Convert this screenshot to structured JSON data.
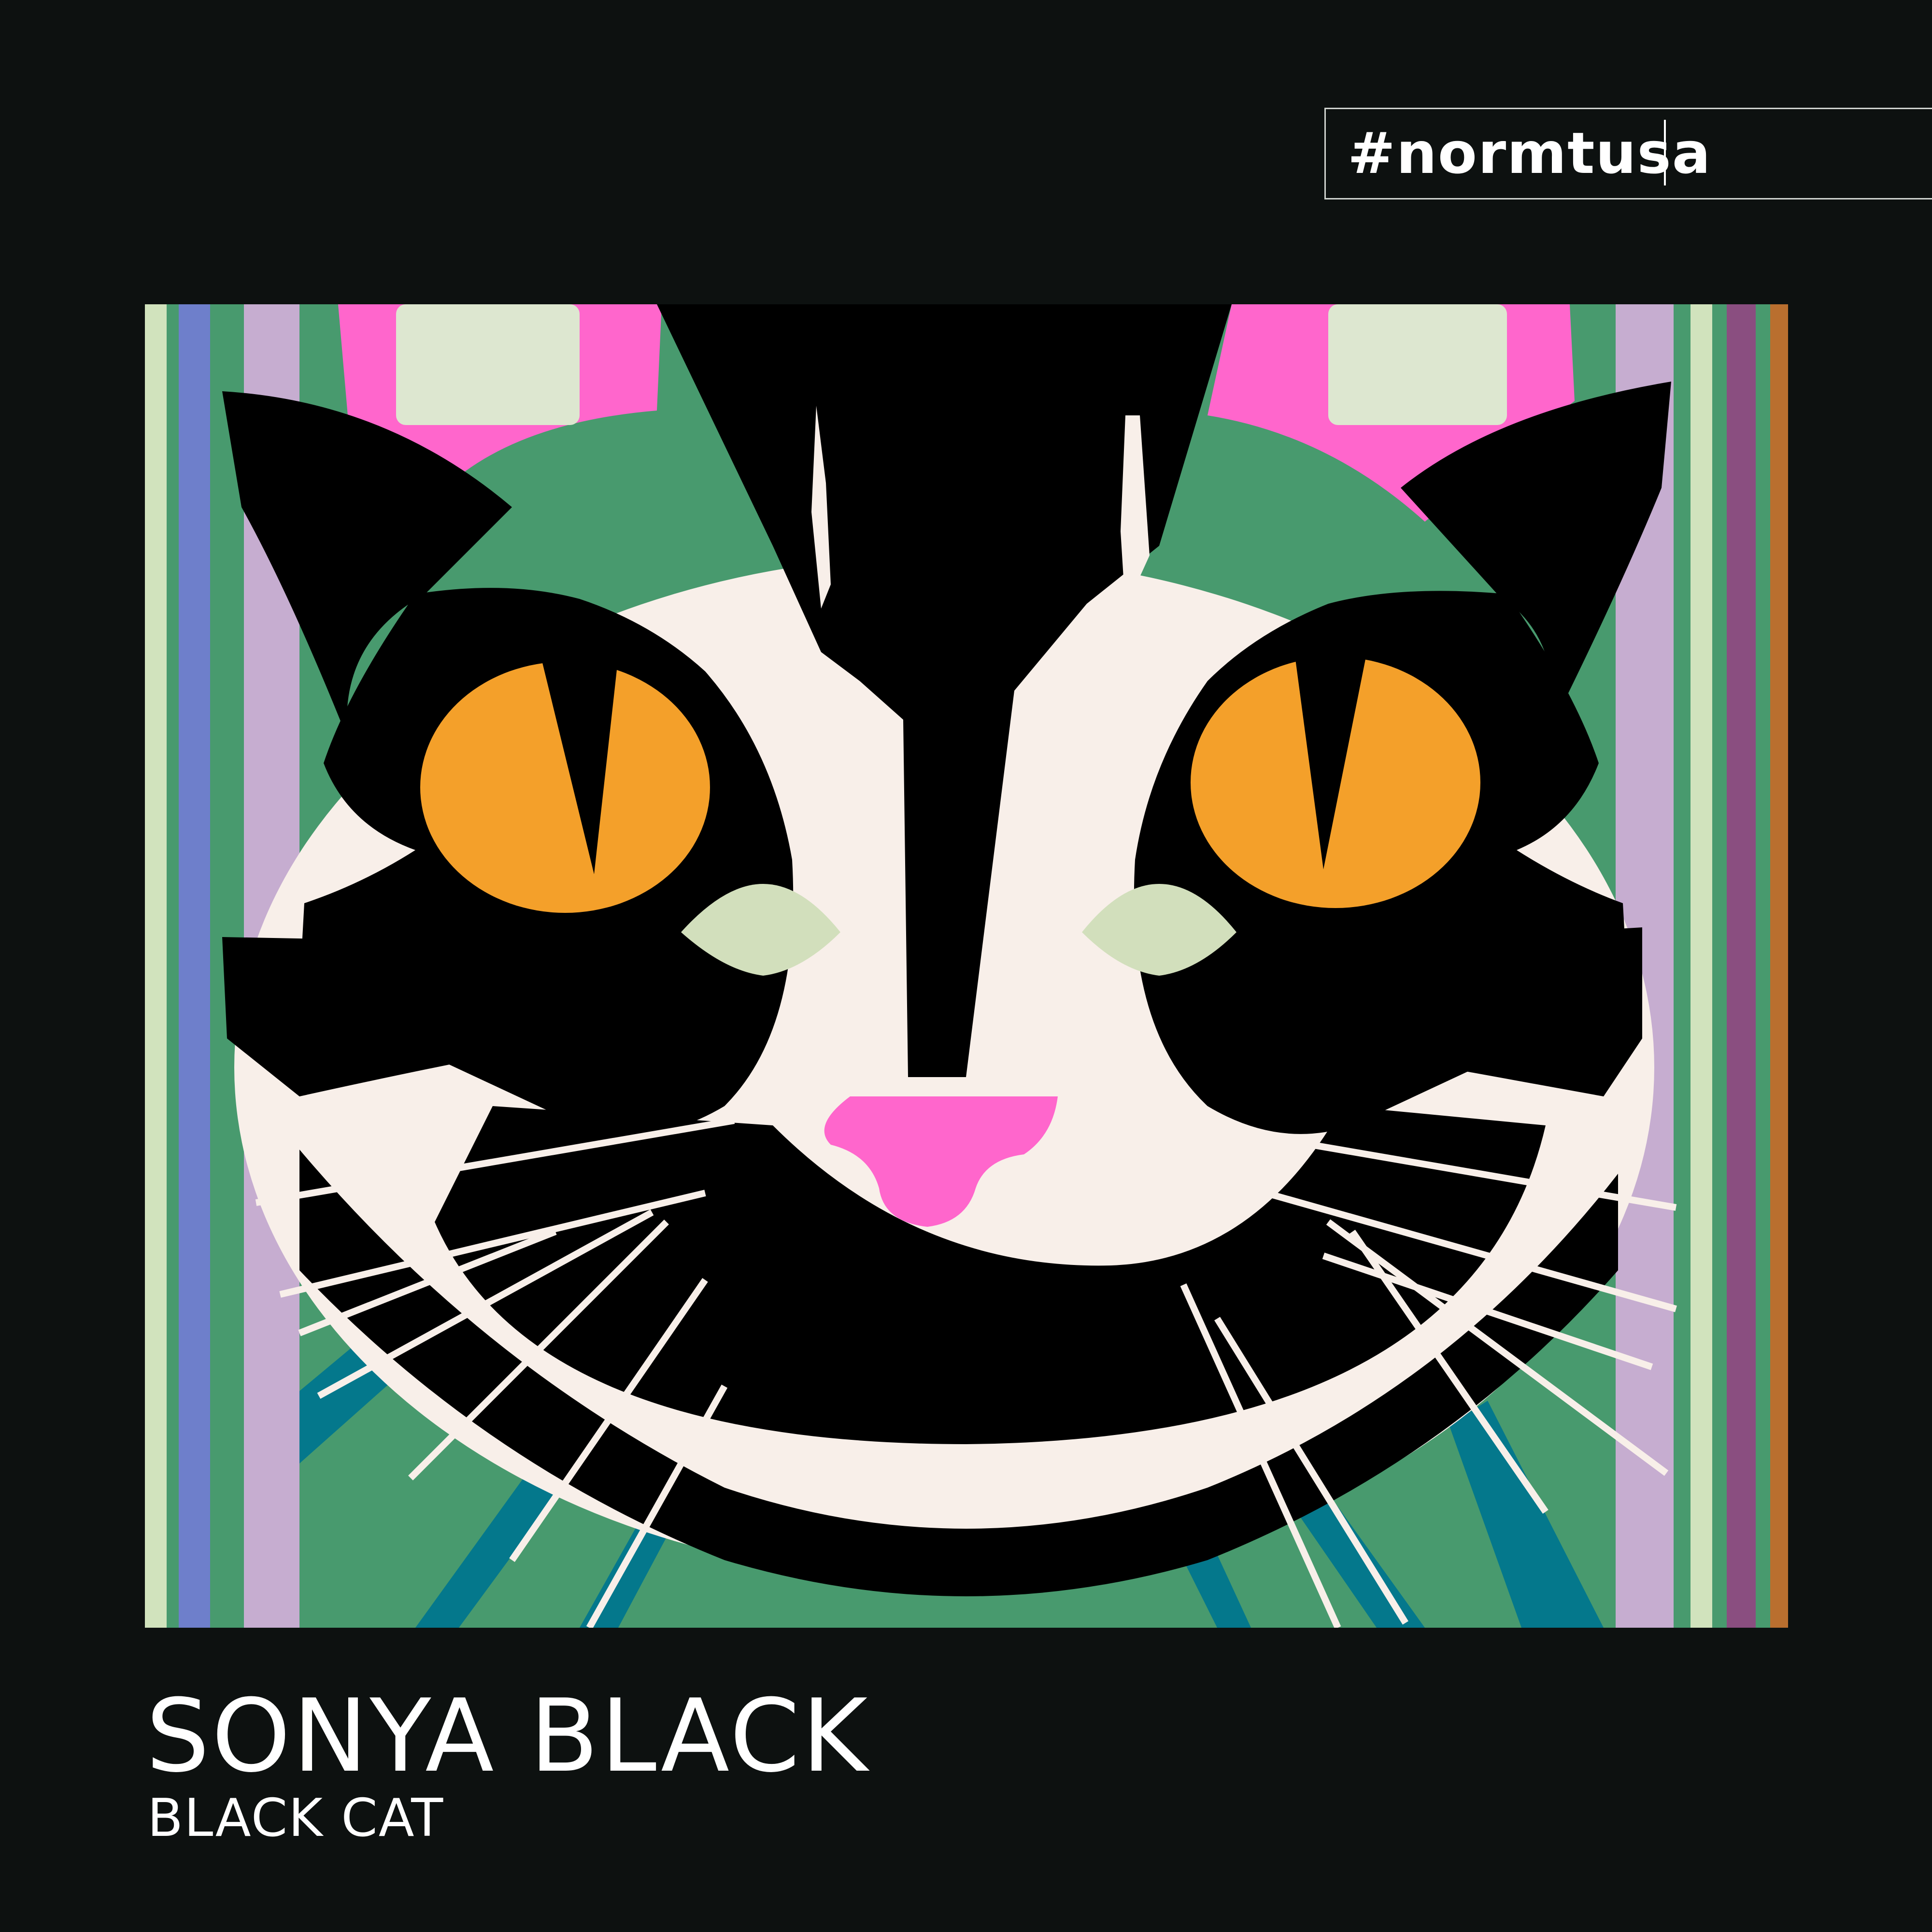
{
  "hashtag": "#normtusa",
  "artist": "SONYA BLACK",
  "title": "BLACK CAT",
  "colors": {
    "background": "#0d1110",
    "fur_black": "#000000",
    "fur_white": "#f8efe9",
    "eye_orange": "#f4a02a",
    "ear_pink": "#ff66cc",
    "nose_pink": "#ff66cc",
    "stripe_green": "#489a6e",
    "stripe_teal": "#04788c",
    "stripe_lilac": "#c6add0",
    "stripe_mint": "#d1e3bd",
    "stripe_blue": "#6e7fcb",
    "stripe_plum": "#8a4e80",
    "stripe_copper": "#b96f2f"
  }
}
